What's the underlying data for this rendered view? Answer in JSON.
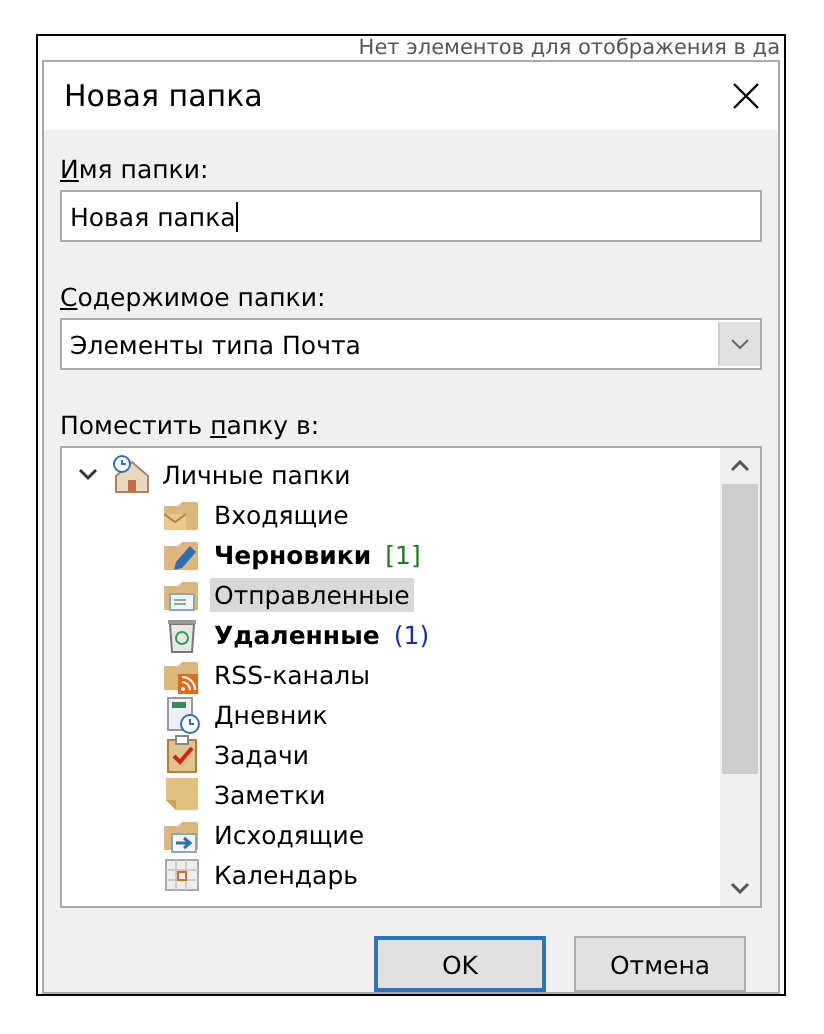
{
  "background_text": "Нет элементов для отображения в да",
  "dialog": {
    "title": "Новая папка",
    "name_field": {
      "label_key": "И",
      "label_rest": "мя папки:",
      "value": "Новая папка"
    },
    "content_field": {
      "label_key": "С",
      "label_rest": "одержимое папки:",
      "value": "Элементы типа Почта"
    },
    "location": {
      "label_before": "Поместить ",
      "label_key": "п",
      "label_after": "апку в:",
      "tree": [
        {
          "name": "Личные папки",
          "kind": "home",
          "expanded": true,
          "bold": false,
          "selected": false,
          "children": [
            {
              "name": "Входящие",
              "kind": "inbox",
              "bold": false,
              "selected": false
            },
            {
              "name": "Черновики",
              "kind": "drafts",
              "bold": true,
              "count": "[1]",
              "color": "#1e7d1e",
              "selected": false
            },
            {
              "name": "Отправленные",
              "kind": "sent",
              "bold": false,
              "selected": true
            },
            {
              "name": "Удаленные",
              "kind": "deleted",
              "bold": true,
              "count": "(1)",
              "color": "#1c2fa8",
              "selected": false
            },
            {
              "name": "RSS-каналы",
              "kind": "rss",
              "bold": false,
              "selected": false
            },
            {
              "name": "Дневник",
              "kind": "journal",
              "bold": false,
              "selected": false
            },
            {
              "name": "Задачи",
              "kind": "tasks",
              "bold": false,
              "selected": false
            },
            {
              "name": "Заметки",
              "kind": "notes",
              "bold": false,
              "selected": false
            },
            {
              "name": "Исходящие",
              "kind": "outbox",
              "bold": false,
              "selected": false
            },
            {
              "name": "Календарь",
              "kind": "calendar",
              "bold": false,
              "selected": false
            }
          ]
        }
      ]
    },
    "buttons": [
      {
        "label": "OK",
        "default": true
      },
      {
        "label": "Отмена",
        "default": false
      }
    ]
  }
}
